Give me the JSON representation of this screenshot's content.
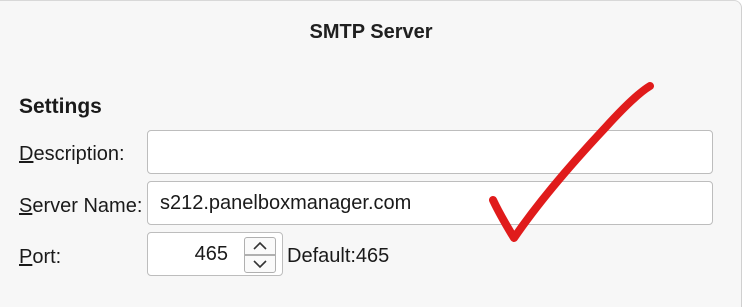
{
  "dialog": {
    "title": "SMTP Server"
  },
  "settings": {
    "heading": "Settings",
    "description": {
      "label_first": "D",
      "label_rest": "escription:",
      "value": ""
    },
    "server_name": {
      "label_first": "S",
      "label_rest": "erver Name:",
      "value": "s212.panelboxmanager.com"
    },
    "port": {
      "label_first": "P",
      "label_rest": "ort:",
      "value": "465",
      "default_text": "Default:465"
    }
  },
  "annotation": {
    "mark": "red-checkmark",
    "color": "#e01b1b"
  }
}
